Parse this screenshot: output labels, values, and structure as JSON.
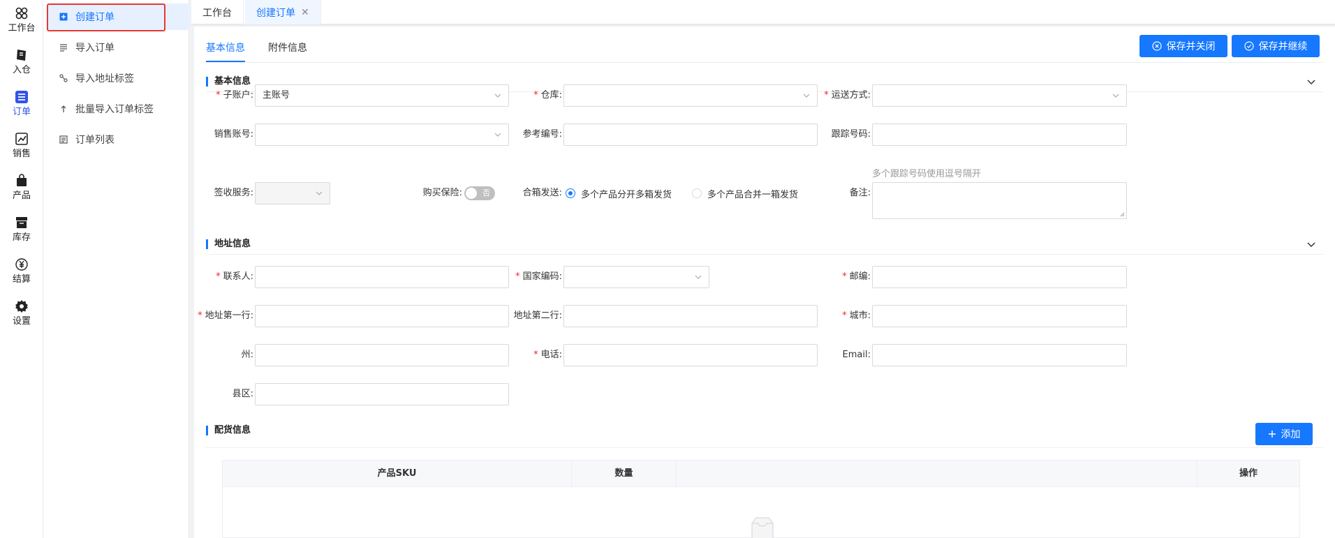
{
  "rail": [
    {
      "label": "工作台",
      "icon": "workspace-icon"
    },
    {
      "label": "入仓",
      "icon": "inbound-icon"
    },
    {
      "label": "订单",
      "icon": "order-list-icon",
      "active": true
    },
    {
      "label": "销售",
      "icon": "sales-icon"
    },
    {
      "label": "产品",
      "icon": "product-bag-icon"
    },
    {
      "label": "库存",
      "icon": "inventory-icon"
    },
    {
      "label": "结算",
      "icon": "yuan-icon"
    },
    {
      "label": "设置",
      "icon": "gear-icon"
    }
  ],
  "submenu": [
    {
      "label": "创建订单",
      "icon": "plus-square-icon",
      "active": true
    },
    {
      "label": "导入订单",
      "icon": "import-icon"
    },
    {
      "label": "导入地址标签",
      "icon": "link-icon"
    },
    {
      "label": "批量导入订单标签",
      "icon": "arrow-up-icon"
    },
    {
      "label": "订单列表",
      "icon": "list-icon"
    }
  ],
  "tabs": {
    "workspace": "工作台",
    "create_order": "创建订单",
    "close": "✕"
  },
  "content_tabs": {
    "basic": "基本信息",
    "attachment": "附件信息"
  },
  "buttons": {
    "save_close": "保存并关闭",
    "save_continue": "保存并继续",
    "add": "添加"
  },
  "sections": {
    "basic": "基本信息",
    "address": "地址信息",
    "picking": "配货信息"
  },
  "basic_form": {
    "sub_account_label": "子账户:",
    "sub_account_value": "主账号",
    "warehouse_label": "仓库:",
    "shipping_label": "运送方式:",
    "sales_account_label": "销售账号:",
    "reference_label": "参考编号:",
    "tracking_label": "跟踪号码:",
    "tracking_hint": "多个跟踪号码使用逗号隔开",
    "sign_service_label": "签收服务:",
    "insurance_label": "购买保险:",
    "insurance_switch_text": "否",
    "combine_label": "合箱发送:",
    "combine_option_1": "多个产品分开多箱发货",
    "combine_option_2": "多个产品合并一箱发货",
    "remark_label": "备注:"
  },
  "address_form": {
    "contact_label": "联系人:",
    "country_label": "国家编码:",
    "zip_label": "邮编:",
    "address1_label": "地址第一行:",
    "address2_label": "地址第二行:",
    "city_label": "城市:",
    "state_label": "州:",
    "phone_label": "电话:",
    "email_label": "Email:",
    "county_label": "县区:"
  },
  "table": {
    "columns": [
      "产品SKU",
      "数量",
      "",
      "操作"
    ]
  },
  "colors": {
    "primary": "#1677ff",
    "required": "#f5222d",
    "highlight": "#e53935"
  }
}
